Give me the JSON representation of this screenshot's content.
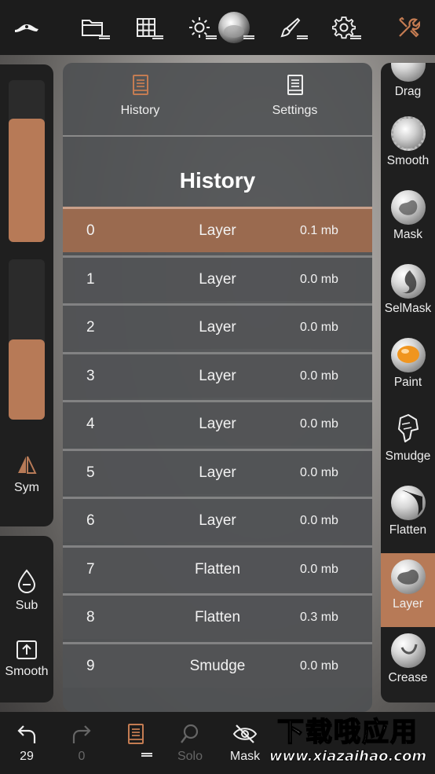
{
  "colors": {
    "accent": "#b77a57",
    "panel_bg": "#1f1f1f",
    "bar_bg": "#1c1c1c",
    "selected_row": "#9a6a4f"
  },
  "topbar": {
    "icons": [
      "sculpt-logo-icon",
      "folder-icon",
      "grid-icon",
      "sun-icon",
      "material-sphere-icon",
      "brush-icon",
      "gear-icon",
      "tools-icon"
    ]
  },
  "left_sliders": {
    "radius_level": 0.76,
    "intensity_level": 0.5
  },
  "left_tools": {
    "sym": "Sym",
    "sub": "Sub",
    "smooth": "Smooth"
  },
  "history_panel": {
    "tabs": [
      {
        "label": "History",
        "icon": "book-icon",
        "active": true
      },
      {
        "label": "Settings",
        "icon": "book-icon",
        "active": false
      }
    ],
    "title": "History",
    "rows": [
      {
        "index": "0",
        "name": "Layer",
        "size": "0.1 mb"
      },
      {
        "index": "1",
        "name": "Layer",
        "size": "0.0 mb"
      },
      {
        "index": "2",
        "name": "Layer",
        "size": "0.0 mb"
      },
      {
        "index": "3",
        "name": "Layer",
        "size": "0.0 mb"
      },
      {
        "index": "4",
        "name": "Layer",
        "size": "0.0 mb"
      },
      {
        "index": "5",
        "name": "Layer",
        "size": "0.0 mb"
      },
      {
        "index": "6",
        "name": "Layer",
        "size": "0.0 mb"
      },
      {
        "index": "7",
        "name": "Flatten",
        "size": "0.0 mb"
      },
      {
        "index": "8",
        "name": "Flatten",
        "size": "0.3 mb"
      },
      {
        "index": "9",
        "name": "Smudge",
        "size": "0.0 mb"
      }
    ]
  },
  "right_tools": [
    {
      "label": "Drag",
      "icon": "drag-tool-icon"
    },
    {
      "label": "Smooth",
      "icon": "smooth-tool-icon"
    },
    {
      "label": "Mask",
      "icon": "mask-tool-icon"
    },
    {
      "label": "SelMask",
      "icon": "selmask-tool-icon"
    },
    {
      "label": "Paint",
      "icon": "paint-tool-icon"
    },
    {
      "label": "Smudge",
      "icon": "smudge-tool-icon"
    },
    {
      "label": "Flatten",
      "icon": "flatten-tool-icon"
    },
    {
      "label": "Layer",
      "icon": "layer-tool-icon",
      "active": true
    },
    {
      "label": "Crease",
      "icon": "crease-tool-icon"
    }
  ],
  "bottombar": {
    "undo_count": "29",
    "redo_count": "0",
    "solo": "Solo",
    "mask": "Mask"
  },
  "watermark": {
    "cn": "下载哦应用",
    "url": "www.xiazaihao.com"
  }
}
